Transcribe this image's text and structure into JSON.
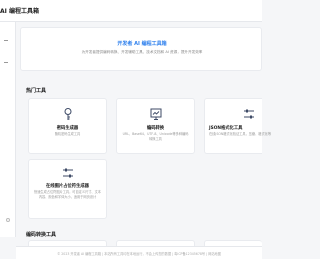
{
  "header": {
    "brand": "AI 编程工具箱"
  },
  "hero": {
    "title": "开发者 AI 编程工具箱",
    "subtitle": "为开发者提供编码转换、开发辅助工具、技术文档和 AI 资源，提升开发效率"
  },
  "sections": {
    "hot_tools": "热门工具",
    "encoding_tools": "编码转换工具"
  },
  "cards": [
    {
      "title": "密码生成器",
      "desc": "随机密码生成工具",
      "icon": "key-icon"
    },
    {
      "title": "编码转换",
      "desc": "URL、Base64、UTF-8、Unicode等多种编码转换工具",
      "icon": "presentation-icon"
    },
    {
      "title": "JSON格式化工具",
      "desc": "在线JSON格式化验证工具，压缩、格式化等",
      "icon": "sliders-icon"
    },
    {
      "title": "在线图片占位符生成器",
      "desc": "快速生成占位符图片工具，可自定义尺寸、文本内容、颜色和字体大小，适用于网页设计",
      "icon": "sliders-icon"
    }
  ],
  "footer": {
    "text": "© 2023 开发者 AI 编程工具箱 | 本站所有工具均在本地运行，不会上传您的数据 | 粤ICP备12345678号 | 网站地图"
  },
  "colors": {
    "accent": "#2f80ed",
    "icon": "#3d4a66"
  }
}
